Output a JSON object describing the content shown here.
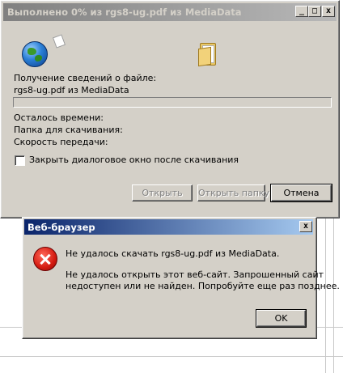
{
  "download_dialog": {
    "title": "Выполнено 0% из rgs8-ug.pdf из MediaData",
    "title_buttons": {
      "minimize": "_",
      "maximize": "□",
      "close": "x"
    },
    "status_label": "Получение сведений о файле:",
    "file_line": "rgs8-ug.pdf из MediaData",
    "progress_fraction": 0,
    "time_left_label": "Осталось времени:",
    "download_folder_label": "Папка для скачивания:",
    "transfer_rate_label": "Скорость передачи:",
    "close_on_complete_label": "Закрыть диалоговое окно после скачивания",
    "close_on_complete_checked": false,
    "buttons": {
      "open": "Открыть",
      "open_folder": "Открыть папку",
      "cancel": "Отмена"
    }
  },
  "error_dialog": {
    "title": "Веб-браузер",
    "close_button": "x",
    "message_line1": "Не удалось скачать rgs8-ug.pdf из MediaData.",
    "message_line2": "Не удалось открыть этот веб-сайт. Запрошенный сайт",
    "message_line3": "недоступен или не найден. Попробуйте еще раз позднее.",
    "ok_button": "OK"
  }
}
